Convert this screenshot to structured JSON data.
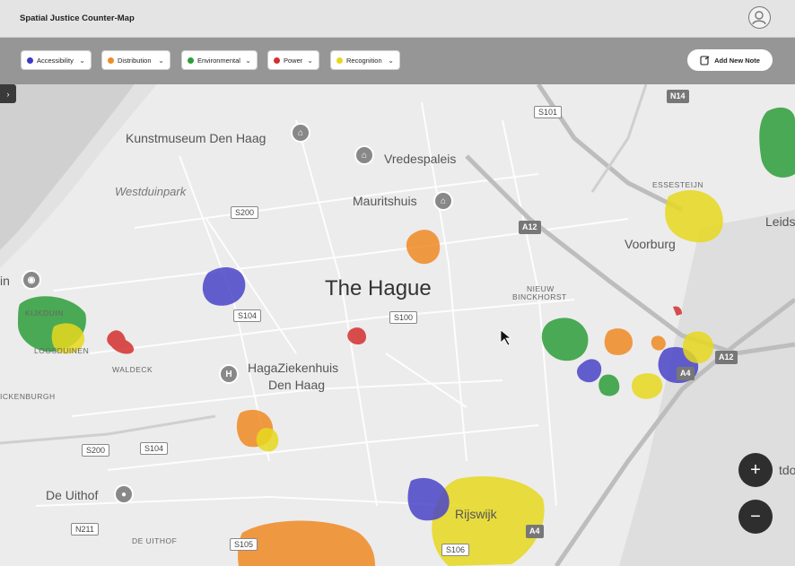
{
  "header": {
    "title": "Spatial Justice Counter-Map"
  },
  "filters": [
    {
      "label": "Accessibility",
      "color": "#3b3bc4"
    },
    {
      "label": "Distribution",
      "color": "#f08a24"
    },
    {
      "label": "Environmental",
      "color": "#2e9d3a"
    },
    {
      "label": "Power",
      "color": "#d32f2f"
    },
    {
      "label": "Recognition",
      "color": "#e6d81e"
    }
  ],
  "toolbar": {
    "add_note_label": "Add New Note"
  },
  "map": {
    "city_label": "The Hague",
    "poi": [
      "Kunstmuseum Den Haag",
      "Vredespaleis",
      "Mauritshuis",
      "HagaZiekenhuis",
      "Den Haag",
      "De Uithof"
    ],
    "park": "Westduinpark",
    "towns": [
      "Voorburg",
      "Rijswijk",
      "Leids"
    ],
    "districts": [
      "KIJKDUIN",
      "LOOSDUINEN",
      "WALDECK",
      "ESSESTEIJN",
      "NIEUW",
      "BINCKHORST",
      "DE UITHOF",
      "ICKENBURGH"
    ],
    "roads": [
      "S101",
      "N14",
      "S200",
      "S104",
      "S100",
      "A12",
      "A12",
      "A4",
      "A4",
      "S200",
      "S104",
      "N211",
      "S105",
      "S106"
    ],
    "fragments": [
      "in",
      "tdor"
    ]
  },
  "controls": {
    "zoom_in": "+",
    "zoom_out": "−",
    "sidebar_toggle": "›"
  }
}
